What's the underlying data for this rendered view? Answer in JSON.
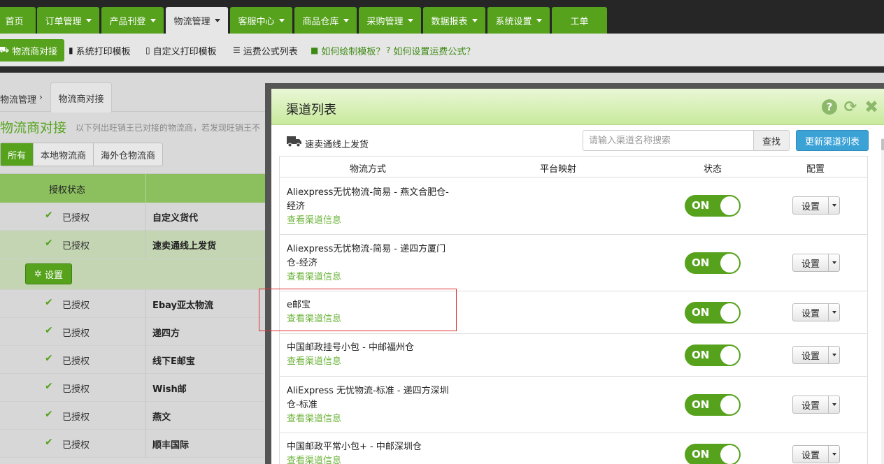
{
  "topnav": {
    "tabs": [
      {
        "label": "首页",
        "caret": false
      },
      {
        "label": "订单管理",
        "caret": true
      },
      {
        "label": "产品刊登",
        "caret": true
      },
      {
        "label": "物流管理",
        "caret": true,
        "active": true
      },
      {
        "label": "客服中心",
        "caret": true
      },
      {
        "label": "商品仓库",
        "caret": true
      },
      {
        "label": "采购管理",
        "caret": true
      },
      {
        "label": "数据报表",
        "caret": true
      },
      {
        "label": "系统设置",
        "caret": true
      },
      {
        "label": "工单",
        "caret": false
      }
    ]
  },
  "subnav": {
    "logistics_connect": "物流商对接",
    "sys_print_template": "系统打印模板",
    "custom_print_template": "自定义打印模板",
    "freight_formula_list": "运费公式列表",
    "how_draw_template": "如何绘制模板？",
    "how_set_formula": "如何设置运费公式？"
  },
  "bg": {
    "breadcrumb_root": "物流管理",
    "breadcrumb_current": "物流商对接",
    "page_title": "物流商对接",
    "page_subtitle": "以下列出旺销王已对接的物流商，若发现旺销王不",
    "filters": [
      "所有",
      "本地物流商",
      "海外仓物流商"
    ],
    "table_header_auth": "授权状态",
    "set_button": "设置",
    "rows_top": [
      {
        "auth": "已授权",
        "name": "自定义货代"
      },
      {
        "auth": "已授权",
        "name": "速卖通线上发货"
      }
    ],
    "rows_bottom": [
      {
        "auth": "已授权",
        "name": "Ebay亚太物流"
      },
      {
        "auth": "已授权",
        "name": "递四方"
      },
      {
        "auth": "已授权",
        "name": "线下E邮宝"
      },
      {
        "auth": "已授权",
        "name": "Wish邮"
      },
      {
        "auth": "已授权",
        "name": "燕文"
      },
      {
        "auth": "已授权",
        "name": "顺丰国际"
      }
    ]
  },
  "modal": {
    "title": "渠道列表",
    "provider_label": "速卖通线上发货",
    "search_placeholder": "请输入渠道名称搜索",
    "search_button": "查找",
    "update_button": "更新渠道列表",
    "columns": {
      "method": "物流方式",
      "mapping": "平台映射",
      "status": "状态",
      "config": "配置"
    },
    "rows": [
      {
        "name": "Aliexpress无忧物流-简易 - 燕文合肥仓-经济",
        "link": "查看渠道信息",
        "status": "ON",
        "config": "设置"
      },
      {
        "name": "Aliexpress无忧物流-简易 - 递四方厦门仓-经济",
        "link": "查看渠道信息",
        "status": "ON",
        "config": "设置"
      },
      {
        "name": "e邮宝",
        "link": "查看渠道信息",
        "status": "ON",
        "config": "设置"
      },
      {
        "name": "中国邮政挂号小包 - 中邮福州仓",
        "link": "查看渠道信息",
        "status": "ON",
        "config": "设置"
      },
      {
        "name": "AliExpress 无忧物流-标准 - 递四方深圳仓-标准",
        "link": "查看渠道信息",
        "status": "ON",
        "config": "设置"
      },
      {
        "name": "中国邮政平常小包+ - 中邮深圳仓",
        "link": "查看渠道信息",
        "status": "ON",
        "config": "设置"
      }
    ]
  },
  "colors": {
    "brand_green": "#56a21d",
    "link_green": "#6cb33a",
    "update_blue": "#3ba2d6",
    "highlight_red": "#e03030"
  }
}
